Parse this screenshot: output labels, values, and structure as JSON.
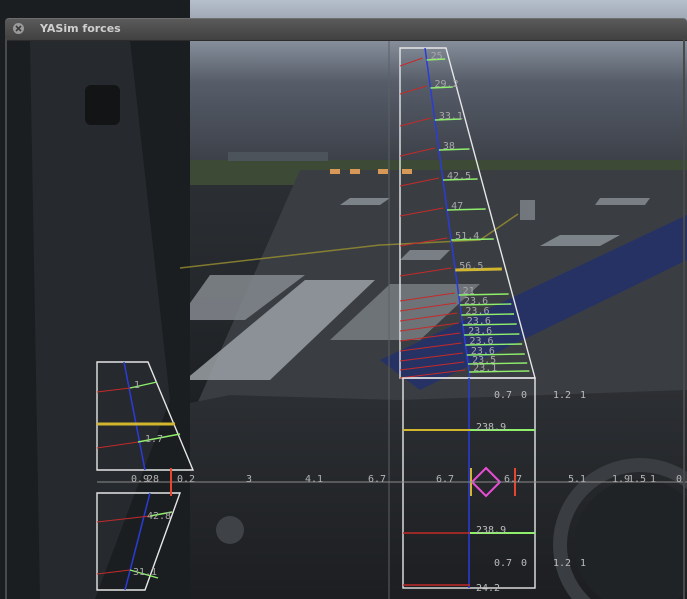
{
  "window": {
    "title": "YASim forces"
  },
  "colors": {
    "outline": "#e6e6e6",
    "lift": "#8fee6c",
    "drag": "#c42a2a",
    "spar": "#2b3bd8",
    "yellow": "#d1b62e",
    "cg_marker": "#e84dd6",
    "red_marker": "#e8452f"
  },
  "main_wing": {
    "segment_labels": [
      "25",
      "29.2",
      "33.1",
      "38",
      "42.5",
      "47",
      "51.4",
      "56.5",
      "21",
      "23.6",
      "23.6",
      "23.6",
      "23.6",
      "23.6",
      "23.6",
      "23.5",
      "23.1"
    ]
  },
  "stabilizer": {
    "labels": [
      "1",
      "1.7",
      "42.8",
      "31.1"
    ]
  },
  "fuselage": {
    "labels_upper": [
      "0.7",
      "0",
      "1.2",
      "1"
    ],
    "force_upper": "238.9",
    "force_lower": "238.9",
    "labels_lower": [
      "0.7",
      "0",
      "1.2",
      "1"
    ],
    "bottom_label": "24.2"
  },
  "axis": {
    "labels": [
      "0.9",
      "28",
      "0.2",
      "3",
      "4.1",
      "6.7",
      "6.7",
      "6.7",
      "5.1",
      "1.9",
      "1.5",
      "1",
      "0"
    ]
  }
}
